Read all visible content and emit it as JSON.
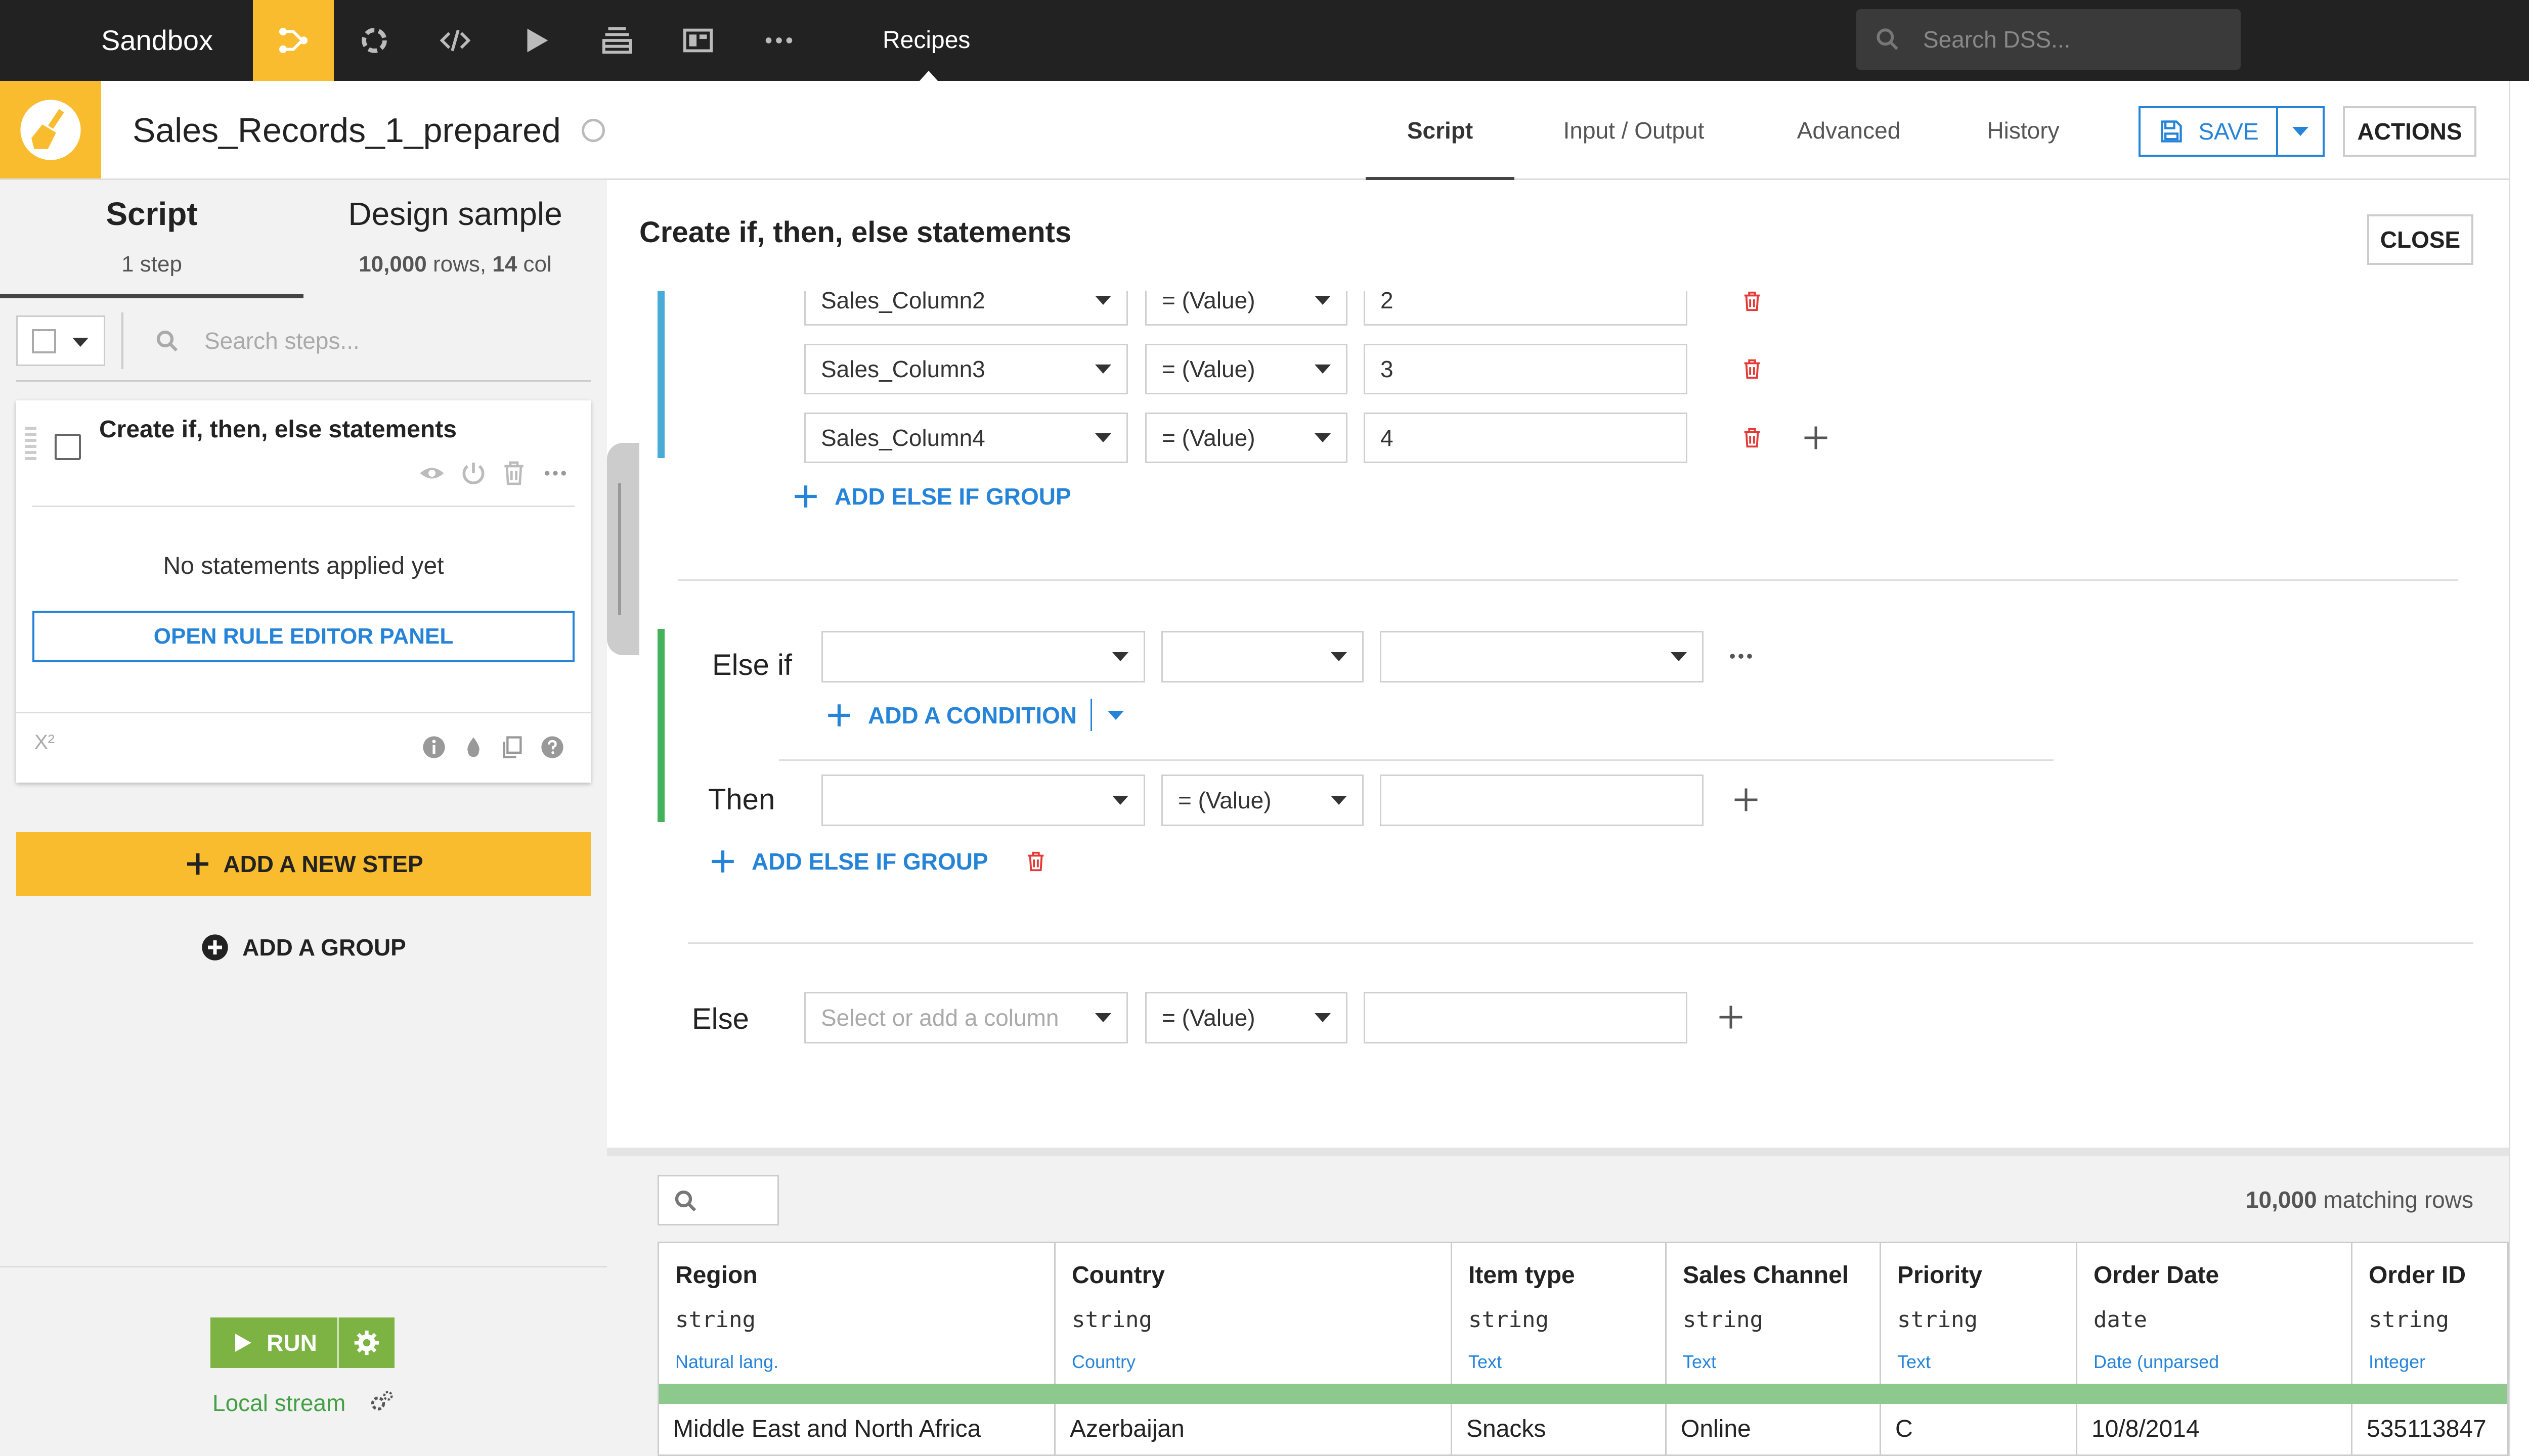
{
  "nav": {
    "brand": "Sandbox",
    "section": "Recipes",
    "search_placeholder": "Search DSS...",
    "icons": [
      "flow-icon",
      "jobs-icon",
      "code-icon",
      "run-icon",
      "datasets-icon",
      "dashboard-icon",
      "more-icon"
    ]
  },
  "header": {
    "recipe_name": "Sales_Records_1_prepared",
    "tabs": [
      {
        "label": "Script",
        "active": true
      },
      {
        "label": "Input / Output"
      },
      {
        "label": "Advanced"
      },
      {
        "label": "History"
      }
    ],
    "save_label": "SAVE",
    "actions_label": "ACTIONS"
  },
  "left": {
    "tab_script": "Script",
    "tab_script_sub": "1 step",
    "tab_sample": "Design sample",
    "tab_sample_rows": "10,000",
    "tab_sample_rows_unit": " rows, ",
    "tab_sample_cols": "14",
    "tab_sample_cols_unit": " col",
    "search_placeholder": "Search steps...",
    "step": {
      "title": "Create if, then, else statements",
      "empty_text": "No statements applied yet",
      "open_editor": "OPEN RULE EDITOR PANEL",
      "formula_glyph": "X²"
    },
    "add_step": "ADD A NEW STEP",
    "add_group": "ADD A GROUP",
    "run_label": "RUN",
    "local_stream": "Local stream"
  },
  "editor": {
    "title": "Create if, then, else statements",
    "close_label": "CLOSE",
    "group1": {
      "rows": [
        {
          "column": "Sales_Column2",
          "op": "= (Value)",
          "value": "2"
        },
        {
          "column": "Sales_Column3",
          "op": "= (Value)",
          "value": "3"
        },
        {
          "column": "Sales_Column4",
          "op": "= (Value)",
          "value": "4"
        }
      ],
      "add_else_if": "ADD ELSE IF GROUP"
    },
    "group2": {
      "else_if_label": "Else if",
      "add_condition": "ADD A CONDITION",
      "then_label": "Then",
      "then_op": "= (Value)",
      "add_else_if": "ADD ELSE IF GROUP"
    },
    "else": {
      "label": "Else",
      "column_placeholder": "Select or add a column",
      "op": "= (Value)"
    }
  },
  "table": {
    "matching_count": "10,000",
    "matching_suffix": " matching rows",
    "columns": [
      {
        "name": "Region",
        "type": "string",
        "meaning": "Natural lang."
      },
      {
        "name": "Country",
        "type": "string",
        "meaning": "Country"
      },
      {
        "name": "Item type",
        "type": "string",
        "meaning": "Text"
      },
      {
        "name": "Sales Channel",
        "type": "string",
        "meaning": "Text"
      },
      {
        "name": "Priority",
        "type": "string",
        "meaning": "Text"
      },
      {
        "name": "Order Date",
        "type": "date",
        "meaning": "Date (unparsed"
      },
      {
        "name": "Order ID",
        "type": "string",
        "meaning": "Integer"
      }
    ],
    "rows": [
      [
        "Middle East and North Africa",
        "Azerbaijan",
        "Snacks",
        "Online",
        "C",
        "10/8/2014",
        "535113847"
      ]
    ]
  },
  "colors": {
    "accent_yellow": "#f9bc2f",
    "nav_bg": "#222222",
    "link_blue": "#2684d8",
    "run_green": "#7cb342",
    "delete_red": "#e53935",
    "group_blue": "#4aaad8",
    "group_green": "#44b25a",
    "valid_bar": "#8dc98d"
  }
}
